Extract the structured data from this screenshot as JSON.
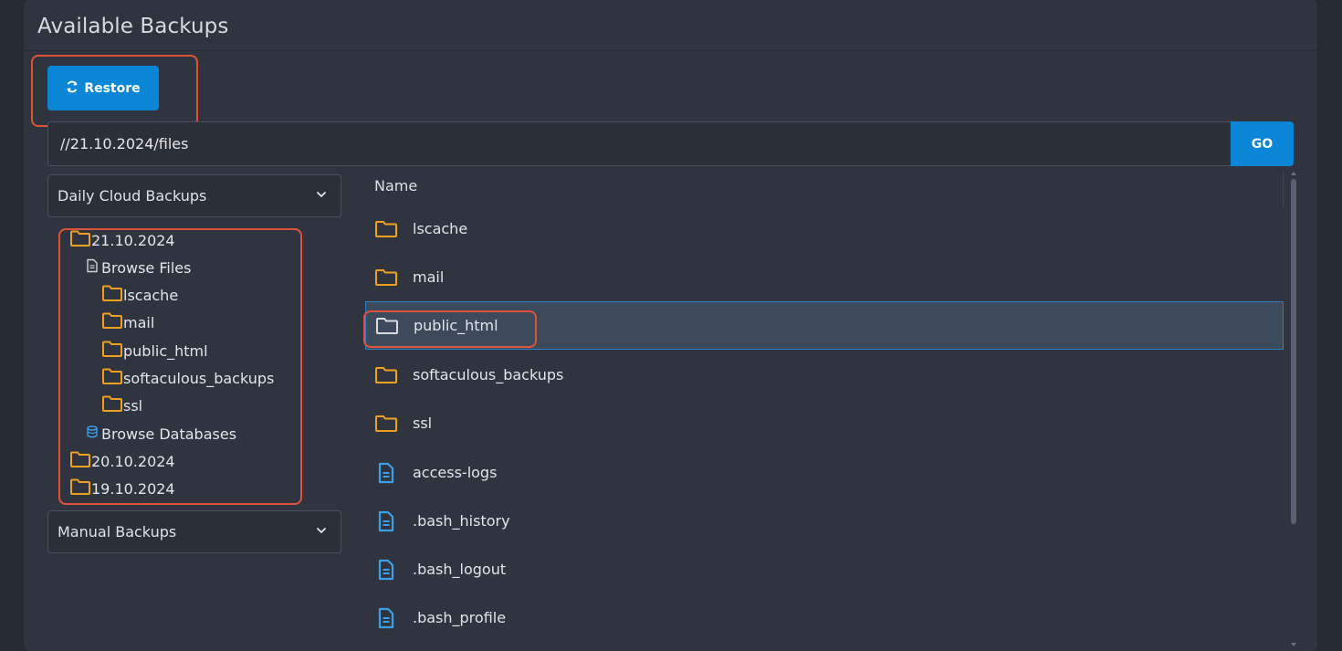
{
  "panel": {
    "title": "Available Backups"
  },
  "restore_button": {
    "label": "Restore",
    "icon": "refresh-icon",
    "color": "#0a86d6"
  },
  "path_bar": {
    "value": "//21.10.2024/files",
    "go_label": "GO"
  },
  "daily_select": {
    "label": "Daily Cloud Backups"
  },
  "manual_select": {
    "label": "Manual Backups"
  },
  "tree": {
    "date1": "21.10.2024",
    "browse_files": "Browse Files",
    "folders": [
      "lscache",
      "mail",
      "public_html",
      "softaculous_backups",
      "ssl"
    ],
    "browse_databases": "Browse Databases",
    "date2": "20.10.2024",
    "date3": "19.10.2024"
  },
  "files": {
    "header": "Name",
    "items": [
      {
        "name": "lscache",
        "type": "folder"
      },
      {
        "name": "mail",
        "type": "folder"
      },
      {
        "name": "public_html",
        "type": "folder",
        "selected": true
      },
      {
        "name": "softaculous_backups",
        "type": "folder"
      },
      {
        "name": "ssl",
        "type": "folder"
      },
      {
        "name": "access-logs",
        "type": "file"
      },
      {
        "name": ".bash_history",
        "type": "file"
      },
      {
        "name": ".bash_logout",
        "type": "file"
      },
      {
        "name": ".bash_profile",
        "type": "file"
      }
    ]
  },
  "colors": {
    "folder": "#f0a020",
    "file": "#3aa0e8",
    "highlight": "#e0533b",
    "accent": "#0a86d6"
  }
}
